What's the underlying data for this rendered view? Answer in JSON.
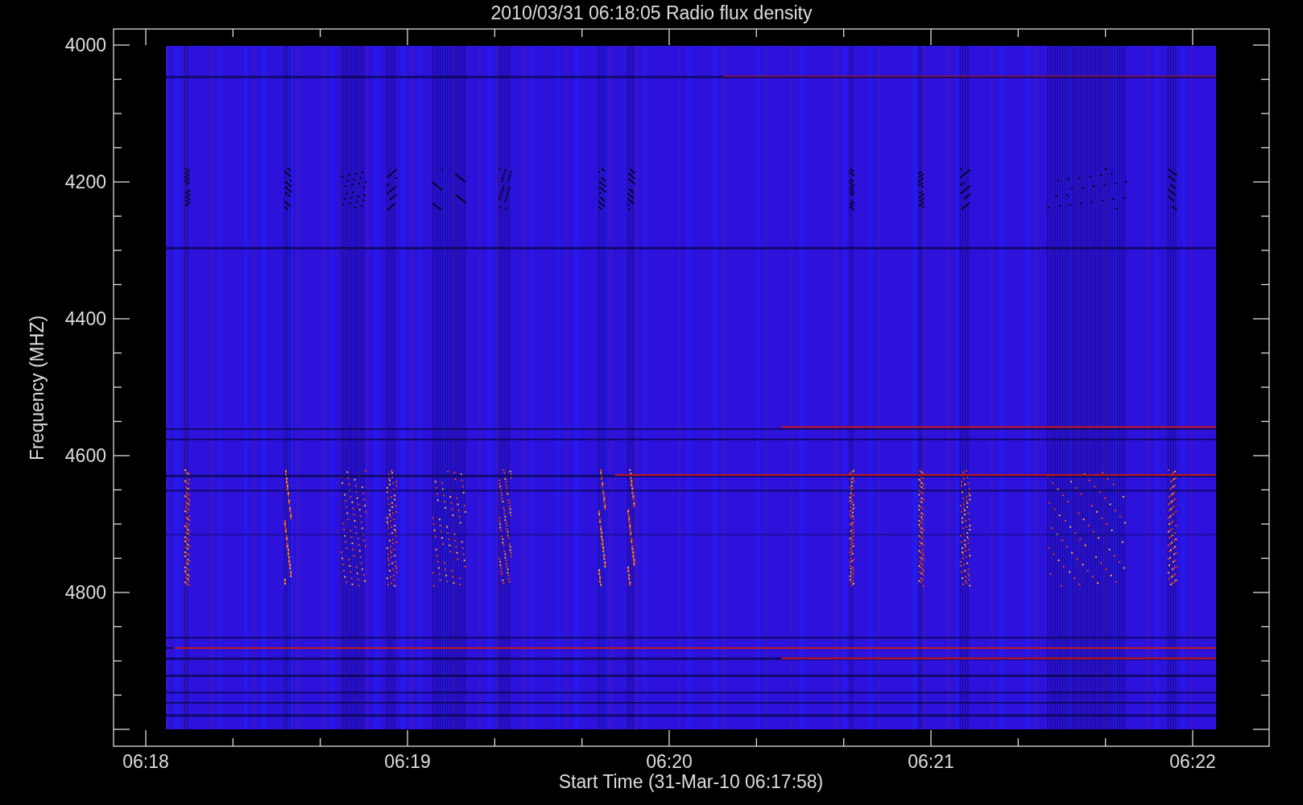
{
  "plot": {
    "title": "2010/03/31 06:18:05 Radio flux density",
    "ylabel": "Frequency (MHZ)",
    "xlabel": "Start Time (31-Mar-10 06:17:58)",
    "y_tick_labels": [
      "4000",
      "4200",
      "4400",
      "4600",
      "4800"
    ],
    "x_tick_labels": [
      "06:18",
      "06:19",
      "06:20",
      "06:21",
      "06:22"
    ]
  }
}
